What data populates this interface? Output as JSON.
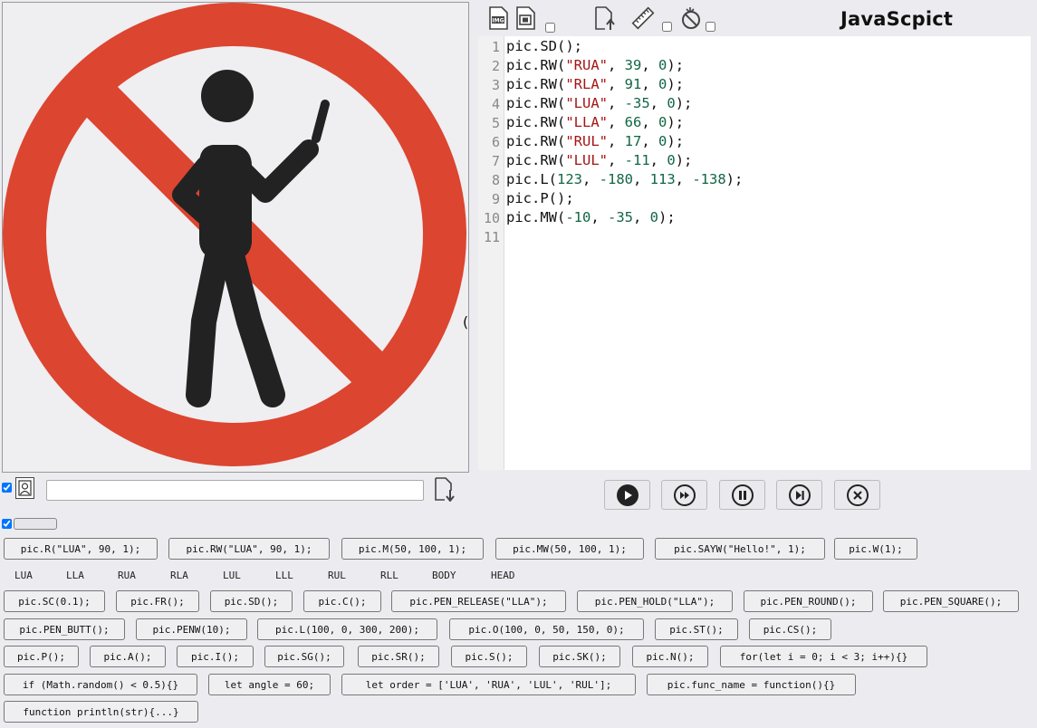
{
  "app": {
    "title": "JavaScpict"
  },
  "toolbar": {
    "icons": [
      "img-file-icon",
      "film-file-icon",
      "file-upload-icon",
      "ruler-icon",
      "no-touch-icon"
    ],
    "checkboxes": {
      "film": false,
      "ruler": false,
      "no_touch": false
    }
  },
  "editor": {
    "line_numbers": [
      "1",
      "2",
      "3",
      "4",
      "5",
      "6",
      "7",
      "8",
      "9",
      "10",
      "11"
    ],
    "lines": [
      [
        {
          "t": "pic.SD();",
          "c": "d"
        }
      ],
      [
        {
          "t": "pic.RW(",
          "c": "d"
        },
        {
          "t": "\"RUA\"",
          "c": "s"
        },
        {
          "t": ", ",
          "c": "d"
        },
        {
          "t": "39",
          "c": "n"
        },
        {
          "t": ", ",
          "c": "d"
        },
        {
          "t": "0",
          "c": "n"
        },
        {
          "t": ");",
          "c": "d"
        }
      ],
      [
        {
          "t": "pic.RW(",
          "c": "d"
        },
        {
          "t": "\"RLA\"",
          "c": "s"
        },
        {
          "t": ", ",
          "c": "d"
        },
        {
          "t": "91",
          "c": "n"
        },
        {
          "t": ", ",
          "c": "d"
        },
        {
          "t": "0",
          "c": "n"
        },
        {
          "t": ");",
          "c": "d"
        }
      ],
      [
        {
          "t": "pic.RW(",
          "c": "d"
        },
        {
          "t": "\"LUA\"",
          "c": "s"
        },
        {
          "t": ", ",
          "c": "d"
        },
        {
          "t": "-35",
          "c": "n"
        },
        {
          "t": ", ",
          "c": "d"
        },
        {
          "t": "0",
          "c": "n"
        },
        {
          "t": ");",
          "c": "d"
        }
      ],
      [
        {
          "t": "pic.RW(",
          "c": "d"
        },
        {
          "t": "\"LLA\"",
          "c": "s"
        },
        {
          "t": ", ",
          "c": "d"
        },
        {
          "t": "66",
          "c": "n"
        },
        {
          "t": ", ",
          "c": "d"
        },
        {
          "t": "0",
          "c": "n"
        },
        {
          "t": ");",
          "c": "d"
        }
      ],
      [
        {
          "t": "pic.RW(",
          "c": "d"
        },
        {
          "t": "\"RUL\"",
          "c": "s"
        },
        {
          "t": ", ",
          "c": "d"
        },
        {
          "t": "17",
          "c": "n"
        },
        {
          "t": ", ",
          "c": "d"
        },
        {
          "t": "0",
          "c": "n"
        },
        {
          "t": ");",
          "c": "d"
        }
      ],
      [
        {
          "t": "pic.RW(",
          "c": "d"
        },
        {
          "t": "\"LUL\"",
          "c": "s"
        },
        {
          "t": ", ",
          "c": "d"
        },
        {
          "t": "-11",
          "c": "n"
        },
        {
          "t": ", ",
          "c": "d"
        },
        {
          "t": "0",
          "c": "n"
        },
        {
          "t": ");",
          "c": "d"
        }
      ],
      [
        {
          "t": "pic.L(",
          "c": "d"
        },
        {
          "t": "123",
          "c": "n"
        },
        {
          "t": ", ",
          "c": "d"
        },
        {
          "t": "-180",
          "c": "n"
        },
        {
          "t": ", ",
          "c": "d"
        },
        {
          "t": "113",
          "c": "n"
        },
        {
          "t": ", ",
          "c": "d"
        },
        {
          "t": "-138",
          "c": "n"
        },
        {
          "t": ");",
          "c": "d"
        }
      ],
      [
        {
          "t": "pic.P();",
          "c": "d"
        }
      ],
      [
        {
          "t": "pic.MW(",
          "c": "d"
        },
        {
          "t": "-10",
          "c": "n"
        },
        {
          "t": ", ",
          "c": "d"
        },
        {
          "t": "-35",
          "c": "n"
        },
        {
          "t": ", ",
          "c": "d"
        },
        {
          "t": "0",
          "c": "n"
        },
        {
          "t": ");",
          "c": "d"
        }
      ],
      []
    ],
    "stray_char": "("
  },
  "controls": {
    "show_checkbox": true,
    "avatar_icon": "portrait-icon",
    "text_input_value": "",
    "save_icon": "file-download-icon",
    "second_checkbox": true,
    "player": [
      "play-icon",
      "fast-forward-icon",
      "pause-icon",
      "step-forward-icon",
      "stop-icon"
    ]
  },
  "part_labels": [
    "LUA",
    "LLA",
    "RUA",
    "RLA",
    "LUL",
    "LLL",
    "RUL",
    "RLL",
    "BODY",
    "HEAD"
  ],
  "snippets": {
    "row1": [
      "pic.R(\"LUA\", 90, 1);",
      "pic.RW(\"LUA\", 90, 1);",
      "pic.M(50, 100, 1);",
      "pic.MW(50, 100, 1);",
      "pic.SAYW(\"Hello!\", 1);",
      "pic.W(1);"
    ],
    "row2": [
      "pic.SC(0.1);",
      "pic.FR();",
      "pic.SD();",
      "pic.C();",
      "pic.PEN_RELEASE(\"LLA\");",
      "pic.PEN_HOLD(\"LLA\");",
      "pic.PEN_ROUND();",
      "pic.PEN_SQUARE();"
    ],
    "row3": [
      "pic.PEN_BUTT();",
      "pic.PENW(10);",
      "pic.L(100, 0, 300, 200);",
      "pic.O(100, 0, 50, 150, 0);",
      "pic.ST();",
      "pic.CS();"
    ],
    "row4": [
      "pic.P();",
      "pic.A();",
      "pic.I();",
      "pic.SG();",
      "pic.SR();",
      "pic.S();",
      "pic.SK();",
      "pic.N();",
      "for(let i = 0; i < 3; i++){}"
    ],
    "row5": [
      "if (Math.random() < 0.5){}",
      "let angle = 60;",
      "let order = ['LUA', 'RUA', 'LUL', 'RUL'];",
      "pic.func_name = function(){}"
    ],
    "row6": [
      "function println(str){...}"
    ]
  },
  "colors": {
    "prohibit_red": "#dc4530",
    "figure": "#222222",
    "string": "#a31515",
    "number": "#116644"
  }
}
